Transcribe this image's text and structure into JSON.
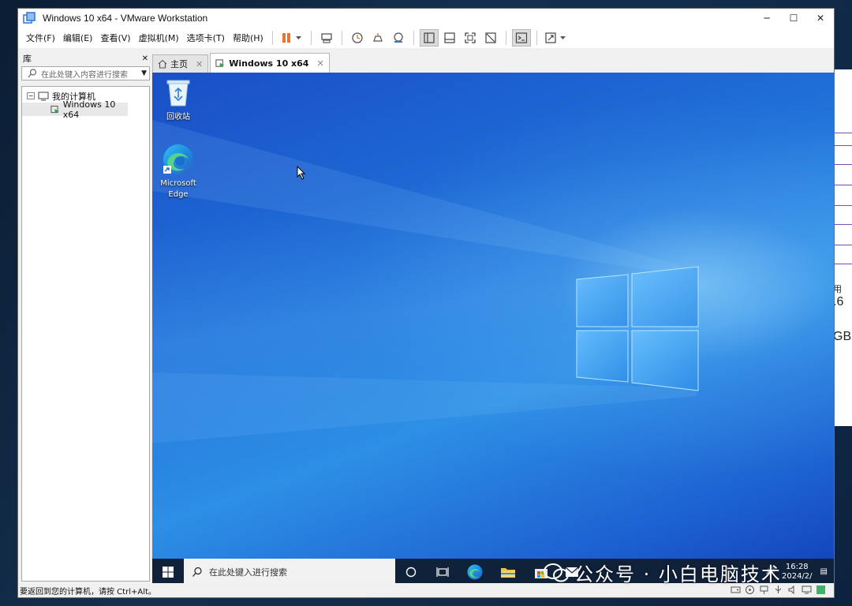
{
  "window": {
    "title": "Windows 10 x64 - VMware Workstation",
    "minimize": "─",
    "maximize": "☐",
    "close": "✕"
  },
  "menu": [
    "文件(F)",
    "编辑(E)",
    "查看(V)",
    "虚拟机(M)",
    "选项卡(T)",
    "帮助(H)"
  ],
  "toolbar": {
    "icons": [
      "pause-icon",
      "send-keys-icon",
      "snapshot-icon",
      "revert-snapshot-icon",
      "snapshot-manager-icon",
      "library-view-icon",
      "thumbnail-bar-icon",
      "fullscreen-icon",
      "unity-icon",
      "console-icon",
      "stretch-icon"
    ]
  },
  "library": {
    "title": "库",
    "close": "✕",
    "search_placeholder": "在此处键入内容进行搜索",
    "tree": {
      "root": "我的计算机",
      "child": "Windows 10 x64"
    }
  },
  "tabs": [
    {
      "label": "主页",
      "close": "✕"
    },
    {
      "label": "Windows 10 x64",
      "close": "✕"
    }
  ],
  "desktop": {
    "icons": [
      {
        "label": "回收站"
      },
      {
        "label": "Microsoft Edge"
      }
    ]
  },
  "taskbar": {
    "search_placeholder": "在此处键入进行搜索",
    "clock_time": "16:28",
    "clock_date": "2024/2/"
  },
  "status": {
    "text": "要返回到您的计算机，请按 Ctrl+Alt。"
  },
  "background_window": {
    "texts": [
      "用",
      ".6",
      "GB"
    ]
  },
  "watermark": {
    "text": "公众号 · 小白电脑技术"
  },
  "colors": {
    "accent": "#1a6fd8",
    "pause": "#e8742b",
    "taskbar": "#10213a"
  }
}
